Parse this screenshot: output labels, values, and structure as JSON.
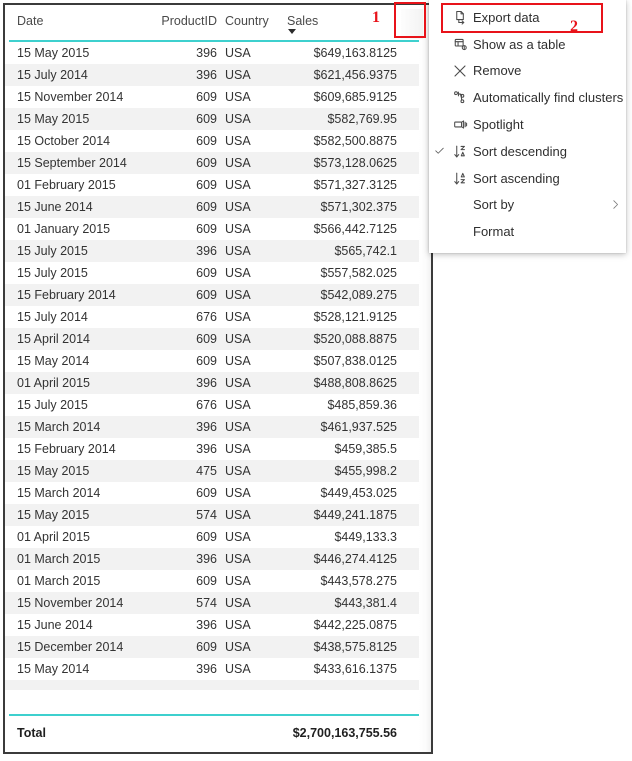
{
  "table": {
    "columns": [
      {
        "key": "date",
        "label": "Date"
      },
      {
        "key": "pid",
        "label": "ProductID"
      },
      {
        "key": "country",
        "label": "Country"
      },
      {
        "key": "sales",
        "label": "Sales"
      }
    ],
    "sort": {
      "column": "Sales",
      "direction": "descending",
      "caret": "sort-descending-caret"
    },
    "rows": [
      {
        "date": "15 May 2015",
        "pid": "396",
        "country": "USA",
        "sales": "$649,163.8125"
      },
      {
        "date": "15 July 2014",
        "pid": "396",
        "country": "USA",
        "sales": "$621,456.9375"
      },
      {
        "date": "15 November 2014",
        "pid": "609",
        "country": "USA",
        "sales": "$609,685.9125"
      },
      {
        "date": "15 May 2015",
        "pid": "609",
        "country": "USA",
        "sales": "$582,769.95"
      },
      {
        "date": "15 October 2014",
        "pid": "609",
        "country": "USA",
        "sales": "$582,500.8875"
      },
      {
        "date": "15 September 2014",
        "pid": "609",
        "country": "USA",
        "sales": "$573,128.0625"
      },
      {
        "date": "01 February 2015",
        "pid": "609",
        "country": "USA",
        "sales": "$571,327.3125"
      },
      {
        "date": "15 June 2014",
        "pid": "609",
        "country": "USA",
        "sales": "$571,302.375"
      },
      {
        "date": "01 January 2015",
        "pid": "609",
        "country": "USA",
        "sales": "$566,442.7125"
      },
      {
        "date": "15 July 2015",
        "pid": "396",
        "country": "USA",
        "sales": "$565,742.1"
      },
      {
        "date": "15 July 2015",
        "pid": "609",
        "country": "USA",
        "sales": "$557,582.025"
      },
      {
        "date": "15 February 2014",
        "pid": "609",
        "country": "USA",
        "sales": "$542,089.275"
      },
      {
        "date": "15 July 2014",
        "pid": "676",
        "country": "USA",
        "sales": "$528,121.9125"
      },
      {
        "date": "15 April 2014",
        "pid": "609",
        "country": "USA",
        "sales": "$520,088.8875"
      },
      {
        "date": "15 May 2014",
        "pid": "609",
        "country": "USA",
        "sales": "$507,838.0125"
      },
      {
        "date": "01 April 2015",
        "pid": "396",
        "country": "USA",
        "sales": "$488,808.8625"
      },
      {
        "date": "15 July 2015",
        "pid": "676",
        "country": "USA",
        "sales": "$485,859.36"
      },
      {
        "date": "15 March 2014",
        "pid": "396",
        "country": "USA",
        "sales": "$461,937.525"
      },
      {
        "date": "15 February 2014",
        "pid": "396",
        "country": "USA",
        "sales": "$459,385.5"
      },
      {
        "date": "15 May 2015",
        "pid": "475",
        "country": "USA",
        "sales": "$455,998.2"
      },
      {
        "date": "15 March 2014",
        "pid": "609",
        "country": "USA",
        "sales": "$449,453.025"
      },
      {
        "date": "15 May 2015",
        "pid": "574",
        "country": "USA",
        "sales": "$449,241.1875"
      },
      {
        "date": "01 April 2015",
        "pid": "609",
        "country": "USA",
        "sales": "$449,133.3"
      },
      {
        "date": "01 March 2015",
        "pid": "396",
        "country": "USA",
        "sales": "$446,274.4125"
      },
      {
        "date": "01 March 2015",
        "pid": "609",
        "country": "USA",
        "sales": "$443,578.275"
      },
      {
        "date": "15 November 2014",
        "pid": "574",
        "country": "USA",
        "sales": "$443,381.4"
      },
      {
        "date": "15 June 2014",
        "pid": "396",
        "country": "USA",
        "sales": "$442,225.0875"
      },
      {
        "date": "15 December 2014",
        "pid": "609",
        "country": "USA",
        "sales": "$438,575.8125"
      },
      {
        "date": "15 May 2014",
        "pid": "396",
        "country": "USA",
        "sales": "$433,616.1375"
      }
    ],
    "total": {
      "label": "Total",
      "value": "$2,700,163,755.56"
    }
  },
  "context_menu": {
    "items": [
      {
        "label": "Export data",
        "icon": "export-data-icon",
        "checked": false,
        "submenu": false
      },
      {
        "label": "Show as a table",
        "icon": "show-as-table-icon",
        "checked": false,
        "submenu": false
      },
      {
        "label": "Remove",
        "icon": "remove-x-icon",
        "checked": false,
        "submenu": false
      },
      {
        "label": "Automatically find clusters",
        "icon": "find-clusters-icon",
        "checked": false,
        "submenu": false
      },
      {
        "label": "Spotlight",
        "icon": "spotlight-icon",
        "checked": false,
        "submenu": false
      },
      {
        "label": "Sort descending",
        "icon": "sort-descending-icon",
        "checked": true,
        "submenu": false
      },
      {
        "label": "Sort ascending",
        "icon": "sort-ascending-icon",
        "checked": false,
        "submenu": false
      },
      {
        "label": "Sort by",
        "icon": "none",
        "checked": false,
        "submenu": true
      },
      {
        "label": "Format",
        "icon": "none",
        "checked": false,
        "submenu": false
      }
    ]
  },
  "annotations": [
    {
      "number": "1",
      "target": "more-options-button"
    },
    {
      "number": "2",
      "target": "export-data-menu-item"
    }
  ],
  "colors": {
    "accent_teal": "#3ed0ce",
    "annotation_red": "#e8131a",
    "row_alt": "#f2f2f2",
    "border": "#3b3b3b"
  }
}
